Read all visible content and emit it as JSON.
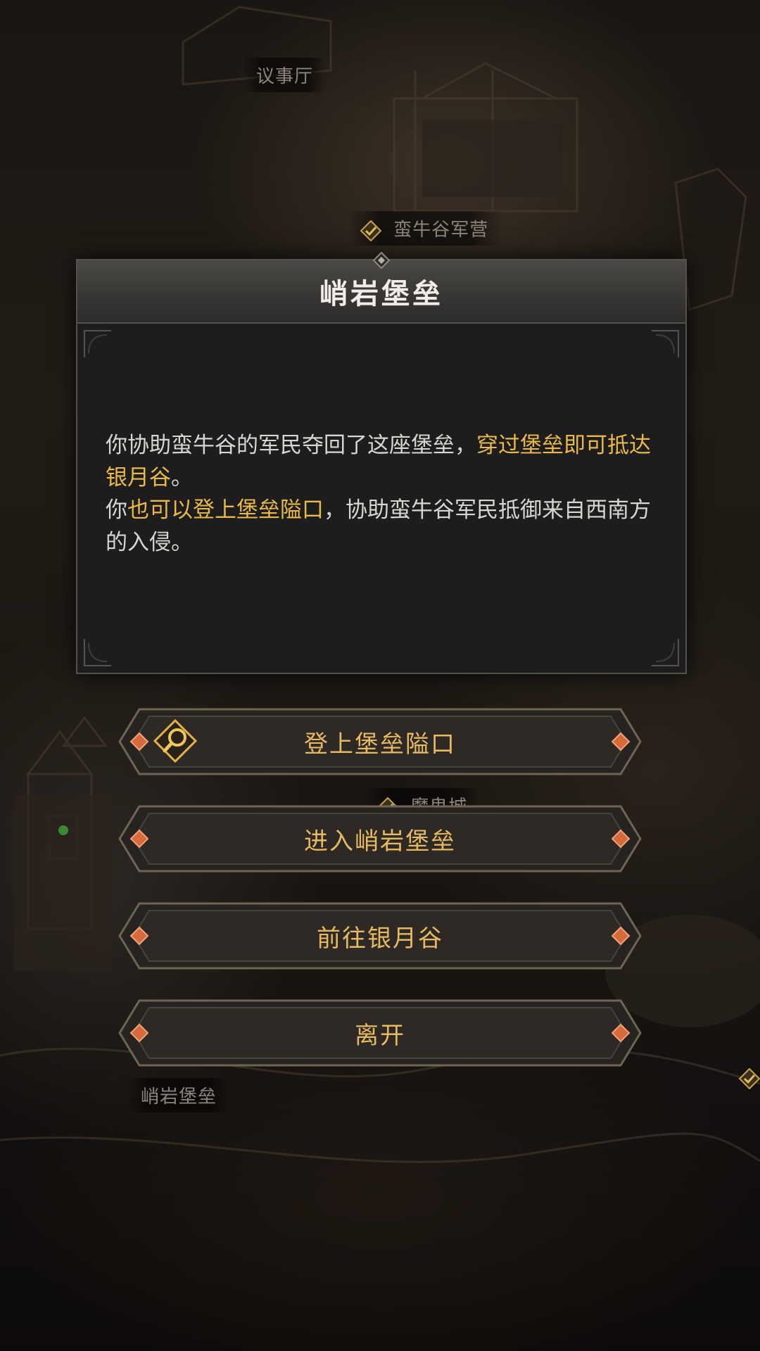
{
  "map_labels": {
    "council_hall": "议事厅",
    "barbarian_camp": "蛮牛谷军营",
    "demon_city": "魔鬼城",
    "fortress_label": "峭岩堡垒"
  },
  "dialog": {
    "title": "峭岩堡垒",
    "line1_plain": "你协助蛮牛谷的军民夺回了这座堡垒，",
    "line1_highlight": "穿过堡垒即可抵达银月谷",
    "line1_end": "。",
    "line2_start": "你",
    "line2_highlight": "也可以登上堡垒隘口",
    "line2_end": "，协助蛮牛谷军民抵御来自西南方的入侵。"
  },
  "actions": [
    {
      "label": "登上堡垒隘口",
      "icon": "magnifier-quest-icon"
    },
    {
      "label": "进入峭岩堡垒"
    },
    {
      "label": "前往银月谷"
    },
    {
      "label": "离开"
    }
  ],
  "colors": {
    "highlight": "#e9b94a",
    "button_text": "#e5ba62",
    "body_text": "#d8d6d1",
    "title_text": "#f1ede6"
  }
}
